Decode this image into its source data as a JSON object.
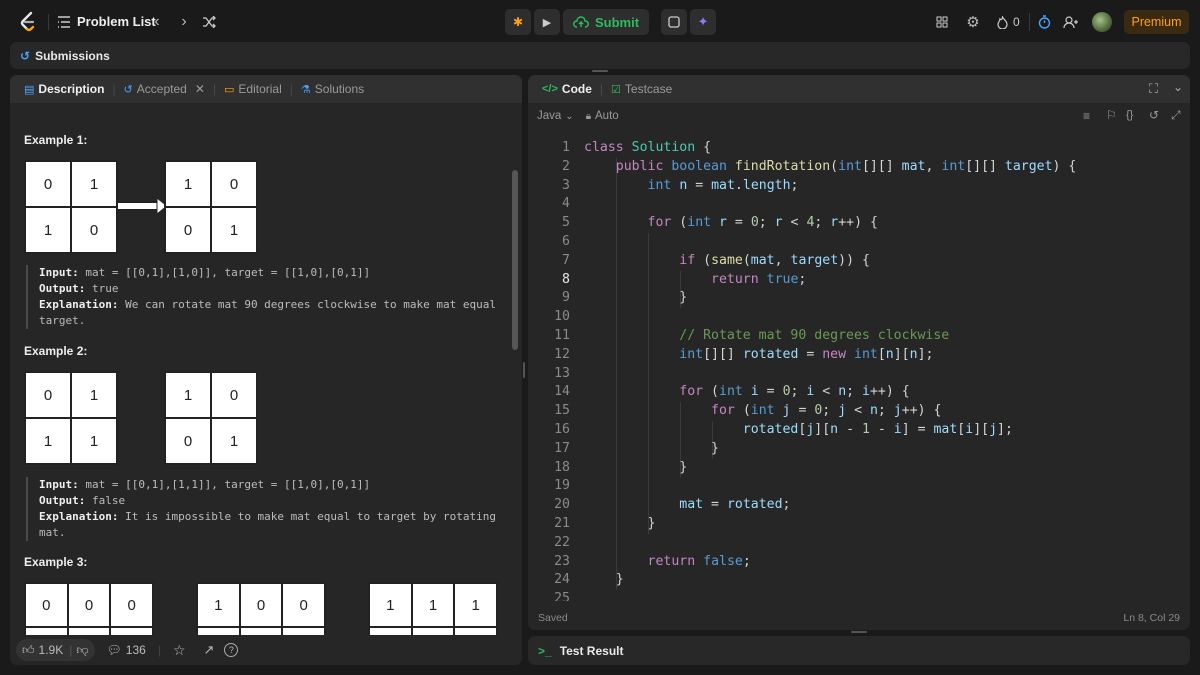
{
  "topbar": {
    "problem_list": "Problem List",
    "submit": "Submit",
    "streak_count": "0",
    "premium": "Premium"
  },
  "submissions_bar": {
    "label": "Submissions"
  },
  "left_tabs": [
    {
      "label": "Description",
      "active": true
    },
    {
      "label": "Accepted",
      "closable": true
    },
    {
      "label": "Editorial"
    },
    {
      "label": "Solutions"
    }
  ],
  "examples": [
    {
      "title": "Example 1:",
      "from": [
        [
          "0",
          "1"
        ],
        [
          "1",
          "0"
        ]
      ],
      "to": [
        [
          "1",
          "0"
        ],
        [
          "0",
          "1"
        ]
      ],
      "input_label": "Input:",
      "input": "mat = [[0,1],[1,0]], target = [[1,0],[0,1]]",
      "output_label": "Output:",
      "output": "true",
      "explanation_label": "Explanation:",
      "explanation": "We can rotate mat 90 degrees clockwise to make mat equal target."
    },
    {
      "title": "Example 2:",
      "from": [
        [
          "0",
          "1"
        ],
        [
          "1",
          "1"
        ]
      ],
      "to": [
        [
          "1",
          "0"
        ],
        [
          "0",
          "1"
        ]
      ],
      "input_label": "Input:",
      "input": "mat = [[0,1],[1,1]], target = [[1,0],[0,1]]",
      "output_label": "Output:",
      "output": "false",
      "explanation_label": "Explanation:",
      "explanation": "It is impossible to make mat equal to target by rotating mat."
    },
    {
      "title": "Example 3:",
      "grid_a_row": [
        "0",
        "0",
        "0"
      ],
      "grid_b_row": [
        "1",
        "0",
        "0"
      ],
      "grid_c_row": [
        "1",
        "1",
        "1"
      ]
    }
  ],
  "bottom_bar": {
    "likes": "1.9K",
    "comments": "136"
  },
  "right_tabs": [
    {
      "label": "Code",
      "active": true
    },
    {
      "label": "Testcase"
    }
  ],
  "editor_toolbar": {
    "language": "Java",
    "mode": "Auto"
  },
  "code_lines": [
    "class Solution {",
    "    public boolean findRotation(int[][] mat, int[][] target) {",
    "        int n = mat.length;",
    "",
    "        for (int r = 0; r < 4; r++) {",
    "",
    "            if (same(mat, target)) {",
    "                return true;",
    "            }",
    "",
    "            // Rotate mat 90 degrees clockwise",
    "            int[][] rotated = new int[n][n];",
    "",
    "            for (int i = 0; i < n; i++) {",
    "                for (int j = 0; j < n; j++) {",
    "                    rotated[j][n - 1 - i] = mat[i][j];",
    "                }",
    "            }",
    "",
    "            mat = rotated;",
    "        }",
    "",
    "        return false;",
    "    }",
    ""
  ],
  "current_line": 8,
  "status": {
    "saved": "Saved",
    "cursor": "Ln 8, Col 29"
  },
  "test_result": {
    "label": "Test Result"
  },
  "colors": {
    "accent_orange": "#ffa116",
    "submit_green": "#2cbb5d",
    "background": "#1a1a1a",
    "panel": "#262626"
  }
}
